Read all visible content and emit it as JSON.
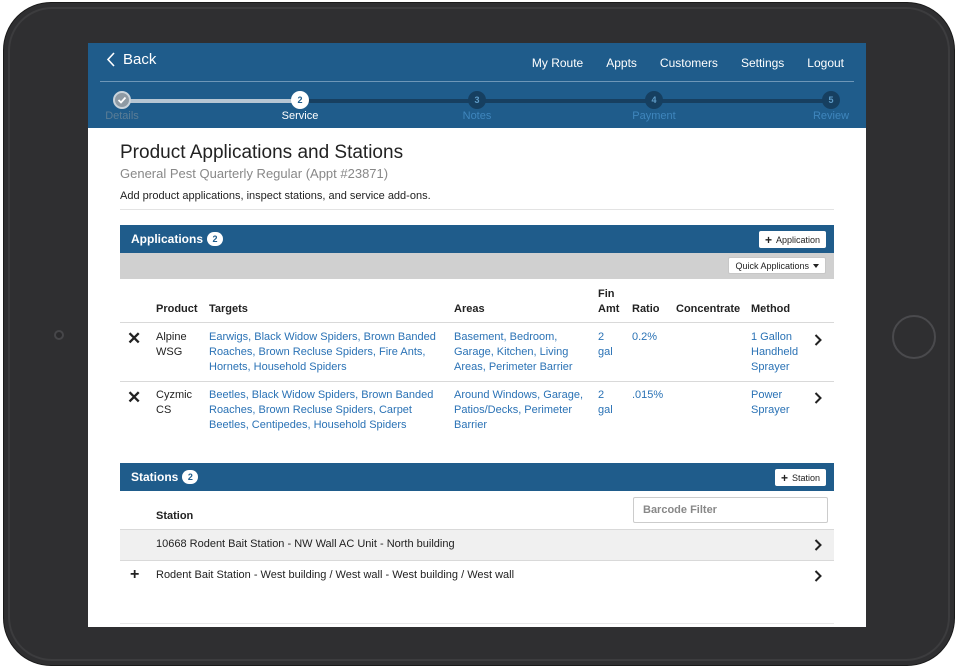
{
  "header": {
    "back_label": "Back",
    "nav": [
      "My Route",
      "Appts",
      "Customers",
      "Settings",
      "Logout"
    ]
  },
  "progress": {
    "steps": [
      {
        "number": "",
        "label": "Details",
        "state": "done"
      },
      {
        "number": "2",
        "label": "Service",
        "state": "active"
      },
      {
        "number": "3",
        "label": "Notes",
        "state": "todo"
      },
      {
        "number": "4",
        "label": "Payment",
        "state": "todo"
      },
      {
        "number": "5",
        "label": "Review",
        "state": "todo"
      }
    ]
  },
  "page": {
    "title": "Product Applications and Stations",
    "subtitle": "General Pest Quarterly Regular (Appt #23871)",
    "description": "Add product applications, inspect stations, and service add-ons."
  },
  "applications": {
    "title": "Applications",
    "count": "2",
    "add_label": "Application",
    "quick_label": "Quick Applications",
    "columns": {
      "product": "Product",
      "targets": "Targets",
      "areas": "Areas",
      "fin_amt_1": "Fin",
      "fin_amt_2": "Amt",
      "ratio": "Ratio",
      "concentrate": "Concentrate",
      "method": "Method"
    },
    "rows": [
      {
        "product": [
          "Alpine",
          "WSG"
        ],
        "targets": [
          "Earwigs, Black Widow Spiders, Brown Banded",
          "Roaches, Brown Recluse Spiders, Fire Ants,",
          "Hornets, Household Spiders"
        ],
        "areas": [
          "Basement, Bedroom,",
          "Garage, Kitchen, Living",
          "Areas, Perimeter Barrier"
        ],
        "fin_amt": [
          "2",
          "gal"
        ],
        "ratio": "0.2%",
        "concentrate": "",
        "method": [
          "1 Gallon",
          "Handheld",
          "Sprayer"
        ]
      },
      {
        "product": [
          "Cyzmic",
          "CS"
        ],
        "targets": [
          "Beetles, Black Widow Spiders, Brown Banded",
          "Roaches, Brown Recluse Spiders, Carpet",
          "Beetles, Centipedes, Household Spiders"
        ],
        "areas": [
          "Around Windows, Garage,",
          "Patios/Decks, Perimeter",
          "Barrier"
        ],
        "fin_amt": [
          "2",
          "gal"
        ],
        "ratio": ".015%",
        "concentrate": "",
        "method": [
          "Power",
          "Sprayer"
        ]
      }
    ]
  },
  "stations": {
    "title": "Stations",
    "count": "2",
    "add_label": "Station",
    "column": "Station",
    "filter_placeholder": "Barcode Filter",
    "rows": [
      {
        "label": "10668 Rodent Bait Station - NW Wall AC Unit - North building"
      },
      {
        "label": "Rodent Bait Station - West building / West wall - West building / West wall"
      }
    ]
  },
  "colors": {
    "brand": "#1f5c8b",
    "link": "#2a72b5"
  }
}
